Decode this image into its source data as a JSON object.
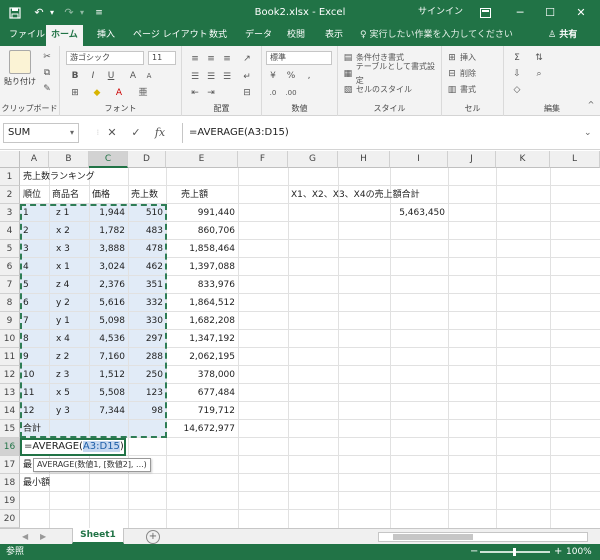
{
  "window": {
    "title": "Book2.xlsx - Excel",
    "signin": "サインイン",
    "ribbon_display_icon": "ribbon-display-icon",
    "minimize": "─",
    "maximize": "☐",
    "close": "✕"
  },
  "tabs": [
    {
      "label": "ファイル"
    },
    {
      "label": "ホーム"
    },
    {
      "label": "挿入"
    },
    {
      "label": "ページ レイアウト"
    },
    {
      "label": "数式"
    },
    {
      "label": "データ"
    },
    {
      "label": "校閲"
    },
    {
      "label": "表示"
    }
  ],
  "tellme": "♀ 実行したい作業を入力してください",
  "share": "♙ 共有",
  "ribbon": {
    "clipboard": {
      "paste": "貼り付け",
      "label": "クリップボード"
    },
    "font": {
      "name": "游ゴシック",
      "size": "11",
      "label": "フォント",
      "bold": "B",
      "italic": "I",
      "underline": "U",
      "grow": "A",
      "shrink": "A"
    },
    "alignment": {
      "label": "配置"
    },
    "number": {
      "format": "標準",
      "percent": "%",
      "label": "数値"
    },
    "styles": {
      "conditional": "条件付き書式",
      "table": "テーブルとして書式設定",
      "cell": "セルのスタイル",
      "label": "スタイル"
    },
    "cells": {
      "insert": "挿入",
      "delete": "削除",
      "format": "書式",
      "label": "セル"
    },
    "editing": {
      "label": "編集",
      "sum": "Σ"
    }
  },
  "formula_bar": {
    "namebox": "SUM",
    "cancel": "✕",
    "enter": "✓",
    "fx": "fx",
    "formula": "=AVERAGE(A3:D15)"
  },
  "columns": [
    "A",
    "B",
    "C",
    "D",
    "E",
    "F",
    "G",
    "H",
    "I",
    "J",
    "K",
    "L"
  ],
  "rows": [
    "1",
    "2",
    "3",
    "4",
    "5",
    "6",
    "7",
    "8",
    "9",
    "10",
    "11",
    "12",
    "13",
    "14",
    "15",
    "16",
    "17",
    "18",
    "19",
    "20"
  ],
  "sheet": {
    "title": "売上数ランキング",
    "headers": [
      "順位",
      "商品名",
      "価格",
      "売上数",
      "売上額"
    ],
    "data": [
      [
        "1",
        "z 1",
        "1,944",
        "510",
        "991,440"
      ],
      [
        "2",
        "x 2",
        "1,782",
        "483",
        "860,706"
      ],
      [
        "3",
        "x 3",
        "3,888",
        "478",
        "1,858,464"
      ],
      [
        "4",
        "x 1",
        "3,024",
        "462",
        "1,397,088"
      ],
      [
        "5",
        "z 4",
        "2,376",
        "351",
        "833,976"
      ],
      [
        "6",
        "y 2",
        "5,616",
        "332",
        "1,864,512"
      ],
      [
        "7",
        "y 1",
        "5,098",
        "330",
        "1,682,208"
      ],
      [
        "8",
        "x 4",
        "4,536",
        "297",
        "1,347,192"
      ],
      [
        "9",
        "z 2",
        "7,160",
        "288",
        "2,062,195"
      ],
      [
        "10",
        "z 3",
        "1,512",
        "250",
        "378,000"
      ],
      [
        "11",
        "x 5",
        "5,508",
        "123",
        "677,484"
      ],
      [
        "12",
        "y 3",
        "7,344",
        "98",
        "719,712"
      ]
    ],
    "total_label": "合計",
    "total_value": "14,672,977",
    "row17": "最",
    "row18": "最小額",
    "g2_label": "X1、X2、X3、X4の売上額合計",
    "i3_value": "5,463,450",
    "edit_prefix": "=AVERAGE(",
    "edit_ref": "A3:D15",
    "edit_suffix": ")",
    "tooltip": "AVERAGE(数値1, [数値2], ...)"
  },
  "sheet_tabs": {
    "name": "Sheet1",
    "add": "+",
    "prev": "◀",
    "next": "▶"
  },
  "status": {
    "mode": "参照",
    "zoom": "100%"
  }
}
